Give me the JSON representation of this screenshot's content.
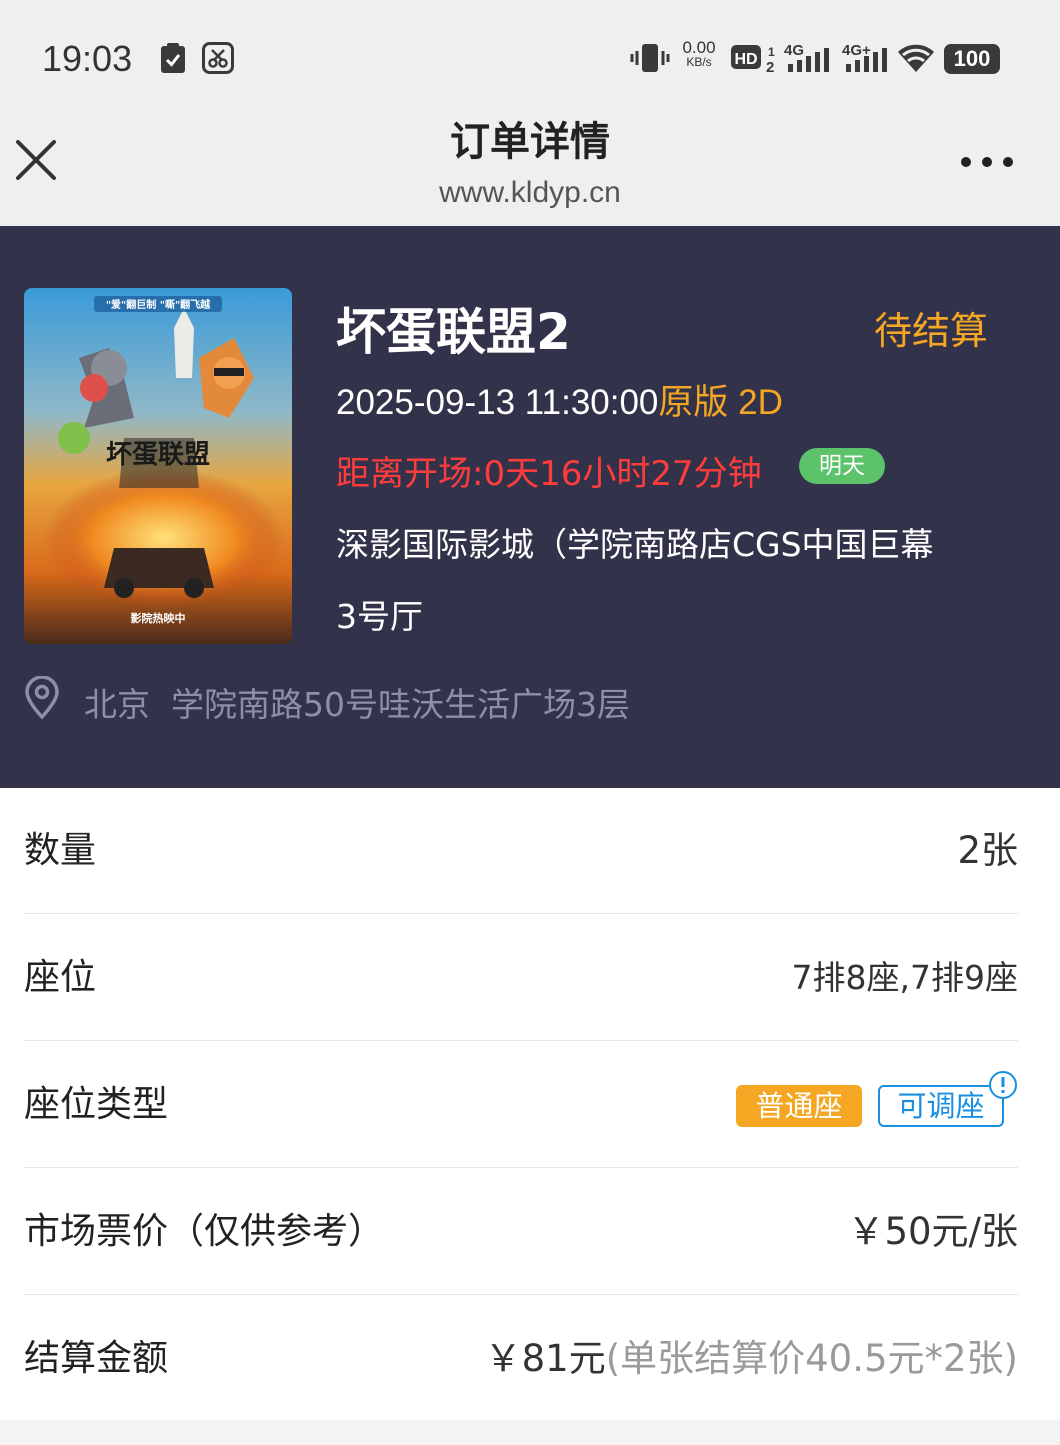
{
  "status_bar": {
    "time": "19:03",
    "net_speed_value": "0.00",
    "net_speed_unit": "KB/s",
    "battery": "100",
    "icons": [
      "clipboard-check-icon",
      "scissors-app-icon",
      "vibrate-icon",
      "hd-voice-icon",
      "signal-4g-icon",
      "signal-4g-plus-icon",
      "wifi-icon",
      "battery-icon"
    ]
  },
  "title_bar": {
    "title": "订单详情",
    "url": "www.kldyp.cn",
    "close_icon": "close-icon",
    "more_icon": "more-dots-icon"
  },
  "movie": {
    "title": "坏蛋联盟2",
    "status": "待结算",
    "datetime": "2025-09-13 11:30:00",
    "version": "原版 2D",
    "countdown": "距离开场:0天16小时27分钟",
    "day_badge": "明天",
    "cinema": "深影国际影城（学院南路店CGS中国巨幕",
    "hall": "3号厅",
    "address": "北京  学院南路50号哇沃生活广场3层",
    "poster": {
      "top_text": "\"爱\"翻巨制  \"嘶\"翻飞越",
      "title_text": "坏蛋联盟",
      "bottom_text": "影院热映中"
    }
  },
  "details": {
    "quantity": {
      "label": "数量",
      "value": "2张"
    },
    "seats": {
      "label": "座位",
      "value": "7排8座,7排9座"
    },
    "seat_type": {
      "label": "座位类型",
      "tag_normal": "普通座",
      "tag_adjust": "可调座"
    },
    "market_price": {
      "label": "市场票价（仅供参考）",
      "value": "￥50元/张"
    },
    "settlement": {
      "label": "结算金额",
      "amount": "￥81元",
      "note": "(单张结算价40.5元*2张)"
    }
  },
  "colors": {
    "header_bg": "#32324a",
    "accent_orange": "#f5a623",
    "countdown_red": "#ff3c3c",
    "badge_green": "#5cc36a",
    "link_blue": "#1a8fe0"
  }
}
